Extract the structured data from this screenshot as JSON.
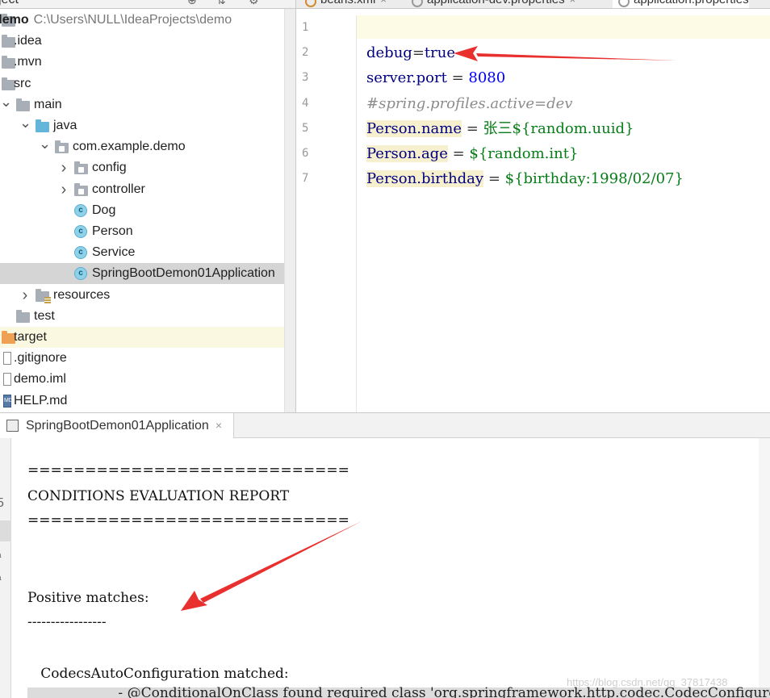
{
  "project_panel": {
    "header_title": "ject",
    "tree": [
      {
        "name": "tree-item-demo",
        "arrow": "",
        "icon": "folder",
        "label": "demo",
        "path": "C:\\Users\\NULL\\IdeaProjects\\demo",
        "bold": true
      },
      {
        "name": "tree-item-idea",
        "arrow": "",
        "icon": "folder",
        "label": ".idea"
      },
      {
        "name": "tree-item-mvn",
        "arrow": "",
        "icon": "folder",
        "label": ".mvn"
      },
      {
        "name": "tree-item-src",
        "arrow": "",
        "icon": "folder",
        "label": "src"
      },
      {
        "name": "tree-item-main",
        "arrow": "expanded",
        "icon": "folder",
        "label": "main"
      },
      {
        "name": "tree-item-java",
        "arrow": "expanded",
        "icon": "folder-blue",
        "label": "java"
      },
      {
        "name": "tree-item-package",
        "arrow": "expanded",
        "icon": "package",
        "label": "com.example.demo"
      },
      {
        "name": "tree-item-config",
        "arrow": "collapsed",
        "icon": "package",
        "label": "config"
      },
      {
        "name": "tree-item-controller",
        "arrow": "collapsed",
        "icon": "package",
        "label": "controller"
      },
      {
        "name": "tree-item-dog",
        "arrow": "",
        "icon": "class",
        "label": "Dog"
      },
      {
        "name": "tree-item-person",
        "arrow": "",
        "icon": "class",
        "label": "Person"
      },
      {
        "name": "tree-item-service",
        "arrow": "",
        "icon": "class",
        "label": "Service"
      },
      {
        "name": "tree-item-application",
        "arrow": "",
        "icon": "spring-class",
        "label": "SpringBootDemon01Application",
        "selected": true
      },
      {
        "name": "tree-item-resources",
        "arrow": "collapsed",
        "icon": "folder-resources",
        "label": "resources"
      },
      {
        "name": "tree-item-test",
        "arrow": "",
        "icon": "folder",
        "label": "test"
      },
      {
        "name": "tree-item-target",
        "arrow": "",
        "icon": "folder-orange",
        "label": "target",
        "excluded": true
      },
      {
        "name": "tree-item-gitignore",
        "arrow": "",
        "icon": "file",
        "label": ".gitignore"
      },
      {
        "name": "tree-item-demo-iml",
        "arrow": "",
        "icon": "file",
        "label": "demo.iml"
      },
      {
        "name": "tree-item-help-md",
        "arrow": "",
        "icon": "file-md",
        "label": "HELP.md"
      }
    ]
  },
  "editor": {
    "tabs": [
      {
        "label": "beans.xml",
        "icon": "xml-file-icon",
        "active": false
      },
      {
        "label": "application-dev.properties",
        "icon": "properties-file-icon",
        "active": false
      },
      {
        "label": "application.properties",
        "icon": "properties-file-icon",
        "active": true
      }
    ],
    "line_numbers": [
      "1",
      "2",
      "3",
      "4",
      "5",
      "6",
      "7"
    ],
    "lines": [
      [],
      [
        {
          "t": "debug",
          "c": "key"
        },
        {
          "t": "=",
          "c": "eq"
        },
        {
          "t": "true",
          "c": "key"
        }
      ],
      [
        {
          "t": "server.port",
          "c": "key"
        },
        {
          "t": " = ",
          "c": "eq"
        },
        {
          "t": "8080",
          "c": "num"
        }
      ],
      [
        {
          "t": "#spring.profiles.active=dev",
          "c": "cmt"
        }
      ],
      [
        {
          "t": "Person.name",
          "c": "key hl"
        },
        {
          "t": " = ",
          "c": "eq"
        },
        {
          "t": "张三",
          "c": "cn"
        },
        {
          "t": "${random.uuid}",
          "c": "str"
        }
      ],
      [
        {
          "t": "Person.age",
          "c": "key hl"
        },
        {
          "t": " = ",
          "c": "eq"
        },
        {
          "t": "${random.int}",
          "c": "str"
        }
      ],
      [
        {
          "t": "Person.birthday",
          "c": "key hl"
        },
        {
          "t": " = ",
          "c": "eq"
        },
        {
          "t": "${birthday:1998/02/07}",
          "c": "str"
        }
      ]
    ]
  },
  "run_panel": {
    "tab_label": "SpringBootDemon01Application",
    "tab_close": "×",
    "console_lines": [
      "============================",
      "CONDITIONS EVALUATION REPORT",
      "============================",
      "",
      "",
      "Positive matches:",
      "-----------------",
      "",
      "   CodecsAutoConfiguration matched:"
    ],
    "partial_line": "      - @ConditionalOnClass found required class 'org.springframework.http.codec.CodecConfigurer'",
    "toolbar_glyphs": [
      "5",
      "■",
      "a",
      "a"
    ]
  },
  "watermark": "https://blog.csdn.net/qq_37817438",
  "annotation_color": "#e8312f"
}
